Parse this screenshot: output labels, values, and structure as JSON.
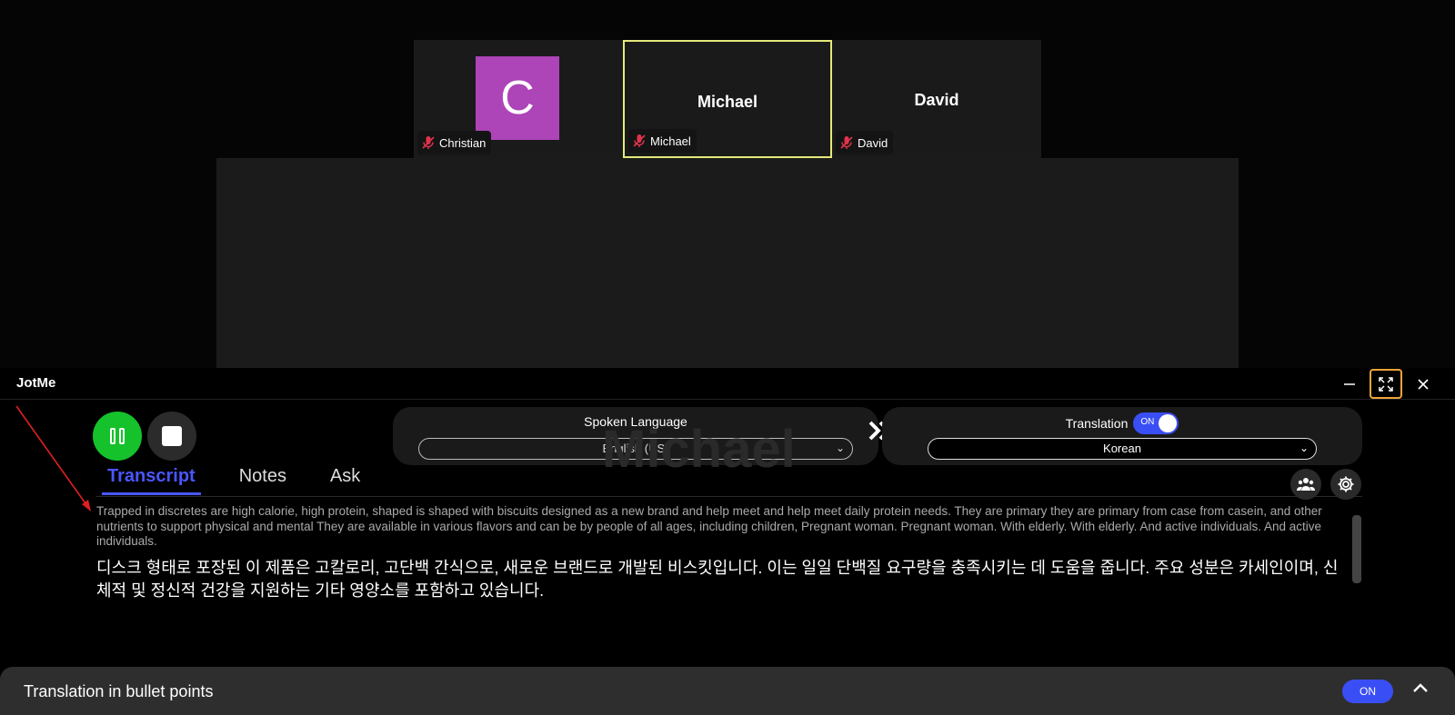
{
  "meeting": {
    "participants": [
      {
        "name": "Christian",
        "initial": "C",
        "label": "Christian"
      },
      {
        "name": "Michael",
        "center_name": "Michael",
        "label": "Michael"
      },
      {
        "name": "David",
        "center_name": "David",
        "label": "David"
      }
    ],
    "colors": {
      "avatar": "#ad44b8",
      "active_border": "#e3ea7a"
    }
  },
  "app": {
    "title": "JotMe",
    "spoken": {
      "title": "Spoken Language",
      "value": "English (US)"
    },
    "translation": {
      "title": "Translation",
      "toggle": "ON",
      "value": "Korean"
    },
    "watermark": "Michael",
    "tabs": [
      {
        "label": "Transcript",
        "active": true
      },
      {
        "label": "Notes",
        "active": false
      },
      {
        "label": "Ask",
        "active": false
      }
    ],
    "transcript": {
      "source": "Trapped in discretes are high calorie, high protein, shaped is shaped with biscuits designed as a new brand and help meet and help meet daily protein needs. They are primary they are primary from case from casein, and other nutrients to support physical and mental They are available in various flavors and can be by people of all ages, including children, Pregnant woman. Pregnant woman. With elderly. With elderly. And active individuals. And active individuals.",
      "translation": "디스크 형태로 포장된 이 제품은 고칼로리, 고단백 간식으로, 새로운 브랜드로 개발된 비스킷입니다. 이는 일일 단백질 요구량을 충족시키는 데 도움을 줍니다. 주요 성분은 카세인이며, 신체적 및 정신적 건강을 지원하는 기타 영양소를 포함하고 있습니다."
    },
    "bottom_bar": {
      "label": "Translation in bullet points",
      "toggle": "ON"
    },
    "colors": {
      "accent": "#3a4ef5",
      "record": "#16c22b",
      "highlight": "#f0a53a"
    }
  }
}
